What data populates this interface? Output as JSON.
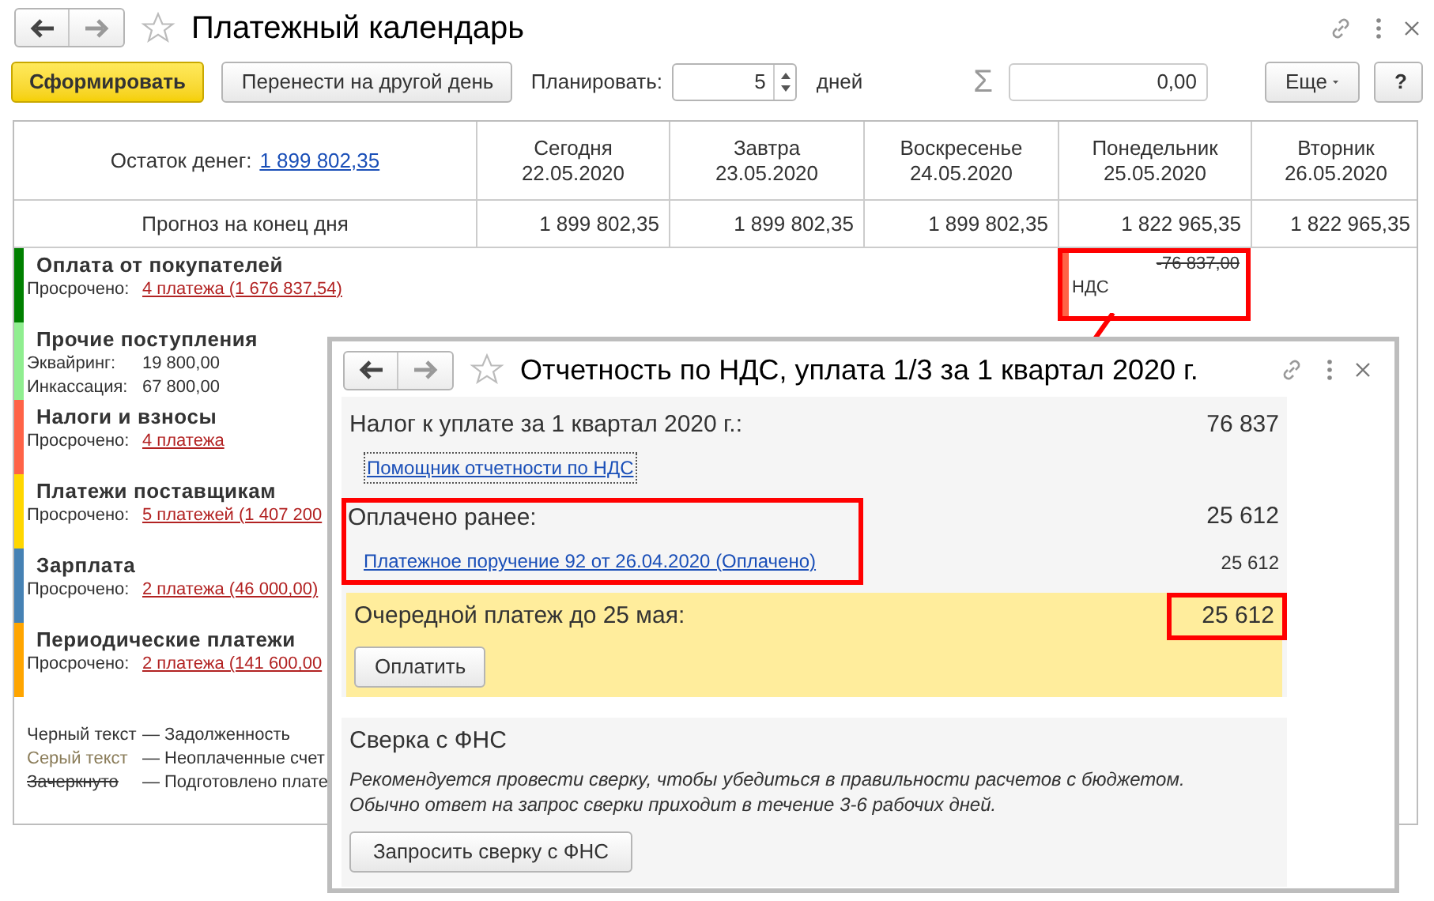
{
  "window": {
    "title": "Платежный календарь"
  },
  "toolbar": {
    "generate_button": "Сформировать",
    "move_button": "Перенести на другой день",
    "plan_label": "Планировать:",
    "plan_value": "5",
    "plan_unit": "дней",
    "sum_symbol": "Σ",
    "sum_value": "0,00",
    "more_button": "Еще",
    "help_button": "?"
  },
  "calendar": {
    "balance_label": "Остаток денег:",
    "balance_value": "1 899 802,35",
    "forecast_label": "Прогноз на конец дня",
    "days": [
      {
        "weekday": "Сегодня",
        "date": "22.05.2020",
        "forecast": "1 899 802,35"
      },
      {
        "weekday": "Завтра",
        "date": "23.05.2020",
        "forecast": "1 899 802,35"
      },
      {
        "weekday": "Воскресенье",
        "date": "24.05.2020",
        "forecast": "1 899 802,35"
      },
      {
        "weekday": "Понедельник",
        "date": "25.05.2020",
        "forecast": "1 822 965,35",
        "entries": [
          {
            "amount": "-76 837,00",
            "struck": true,
            "label": "НДС",
            "color": "#ff6347",
            "highlighted": true
          }
        ]
      },
      {
        "weekday": "Вторник",
        "date": "26.05.2020",
        "forecast": "1 822 965,35"
      }
    ]
  },
  "categories": [
    {
      "name": "Оплата от покупателей",
      "color": "#008000",
      "lines": [
        {
          "kind": "overdue",
          "label": "Просрочено:",
          "value": "4 платежа (1 676 837,54)"
        }
      ]
    },
    {
      "name": "Прочие поступления",
      "color": "#90ee90",
      "lines": [
        {
          "kind": "amount",
          "label": "Эквайринг:",
          "value": "19 800,00"
        },
        {
          "kind": "amount",
          "label": "Инкассация:",
          "value": "67 800,00"
        }
      ]
    },
    {
      "name": "Налоги и взносы",
      "color": "#ff6347",
      "lines": [
        {
          "kind": "overdue",
          "label": "Просрочено:",
          "value": "4 платежа"
        }
      ]
    },
    {
      "name": "Платежи поставщикам",
      "color": "#ffd700",
      "lines": [
        {
          "kind": "overdue",
          "label": "Просрочено:",
          "value": "5 платежей (1 407 200"
        }
      ]
    },
    {
      "name": "Зарплата",
      "color": "#4682b4",
      "lines": [
        {
          "kind": "overdue",
          "label": "Просрочено:",
          "value": "2 платежа (46 000,00)"
        }
      ]
    },
    {
      "name": "Периодические платежи",
      "color": "#ffa500",
      "lines": [
        {
          "kind": "overdue",
          "label": "Просрочено:",
          "value": "2 платежа (141 600,00"
        }
      ]
    }
  ],
  "legend": [
    {
      "kind": "plain",
      "sample": "Черный текст",
      "dash": "—",
      "meaning": "Задолженность"
    },
    {
      "kind": "gray",
      "sample": "Серый текст",
      "dash": "—",
      "meaning": "Неоплаченные счет"
    },
    {
      "kind": "struck",
      "sample": "Зачеркнуто",
      "dash": "—",
      "meaning": "Подготовлено плате"
    }
  ],
  "popup": {
    "title": "Отчетность по НДС, уплата 1/3 за 1 квартал 2020 г.",
    "tax_label": "Налог к уплате за 1 квартал 2020 г.:",
    "tax_value": "76 837",
    "assistant_link": "Помощник отчетности по НДС",
    "paid_label": "Оплачено ранее:",
    "paid_value": "25 612",
    "payment_link": "Платежное поручение 92 от 26.04.2020 (Оплачено)",
    "payment_value": "25 612",
    "next_label": "Очередной платеж до 25 мая:",
    "next_value": "25 612",
    "pay_button": "Оплатить",
    "reconcile": {
      "title": "Сверка с ФНС",
      "note": "Рекомендуется провести сверку, чтобы убедиться в правильности расчетов с бюджетом.\nОбычно ответ на запрос сверки приходит в течение 3-6 рабочих дней.",
      "button": "Запросить сверку с ФНС"
    }
  }
}
